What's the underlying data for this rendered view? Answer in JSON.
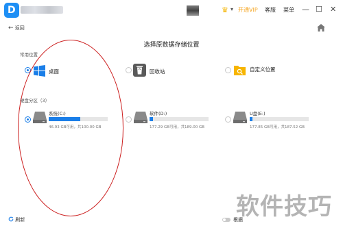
{
  "app": {
    "logo_letter": "D"
  },
  "titlebar": {
    "vip_label": "开通VIP",
    "service_label": "客服",
    "menu_label": "菜单",
    "caret": "▾",
    "crown": "♛",
    "minimize": "—",
    "maximize": "☐",
    "close": "✕"
  },
  "nav": {
    "back_label": "返回",
    "back_arrow": "←"
  },
  "page": {
    "title": "选择原数据存储位置"
  },
  "common": {
    "section_label": "常用位置",
    "locations": [
      {
        "label": "桌面",
        "icon": "windows-icon",
        "selected": true
      },
      {
        "label": "回收站",
        "icon": "recycle-bin-icon",
        "selected": false
      },
      {
        "label": "自定义位置",
        "icon": "folder-search-icon",
        "selected": false
      }
    ]
  },
  "disks": {
    "section_label": "硬盘分区（3）",
    "items": [
      {
        "name": "系统(C:)",
        "info": "46.93 GB可用，共100.00 GB",
        "used_fraction": 0.53,
        "selected": true
      },
      {
        "name": "软件(D:)",
        "info": "177.29 GB可用，共189.00 GB",
        "used_fraction": 0.06,
        "selected": false
      },
      {
        "name": "U盘(E:)",
        "info": "177.85 GB可用，共187.52 GB",
        "used_fraction": 0.05,
        "selected": false
      }
    ]
  },
  "footer": {
    "refresh_label": "刷新",
    "partial_text": "根据"
  },
  "watermark": {
    "text": "软件技巧"
  },
  "colors": {
    "accent": "#1a7ee8",
    "annotation": "#cc1f1f",
    "vip": "#f5a623"
  }
}
